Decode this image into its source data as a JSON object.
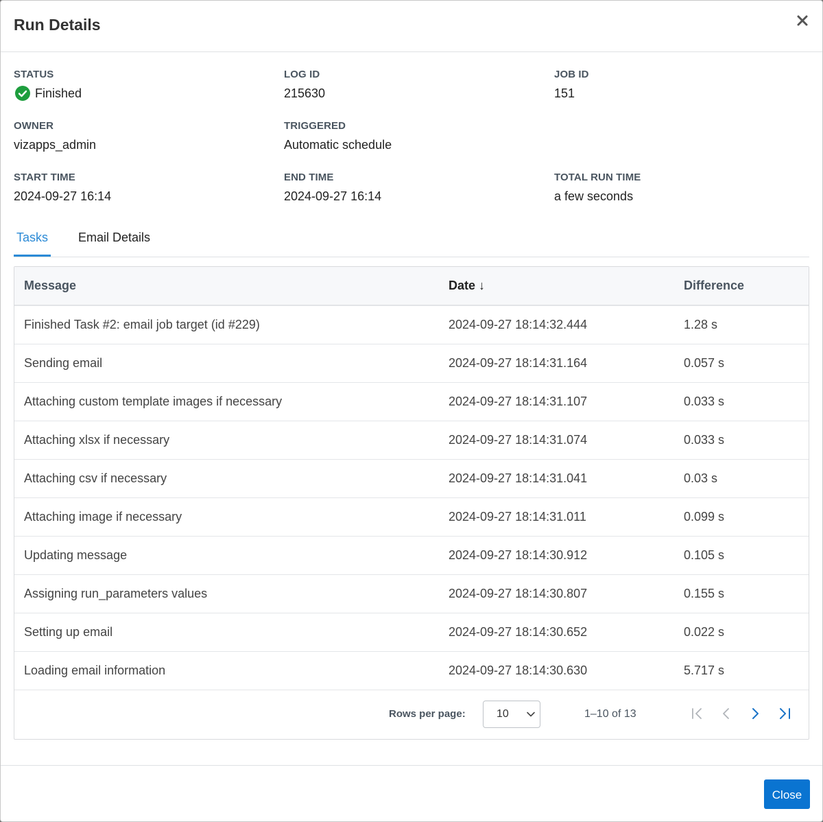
{
  "modal": {
    "title": "Run Details",
    "close_icon": "close-icon"
  },
  "details": {
    "status": {
      "label": "STATUS",
      "value": "Finished",
      "icon": "check-circle-icon",
      "color": "#1e9e3e"
    },
    "log_id": {
      "label": "LOG ID",
      "value": "215630"
    },
    "job_id": {
      "label": "JOB ID",
      "value": "151"
    },
    "owner": {
      "label": "OWNER",
      "value": "vizapps_admin"
    },
    "triggered": {
      "label": "TRIGGERED",
      "value": "Automatic schedule"
    },
    "start_time": {
      "label": "START TIME",
      "value": "2024-09-27 16:14"
    },
    "end_time": {
      "label": "END TIME",
      "value": "2024-09-27 16:14"
    },
    "total_run_time": {
      "label": "TOTAL RUN TIME",
      "value": "a few seconds"
    }
  },
  "tabs": [
    {
      "label": "Tasks",
      "active": true
    },
    {
      "label": "Email Details",
      "active": false
    }
  ],
  "table": {
    "columns": [
      "Message",
      "Date ↓",
      "Difference"
    ],
    "sort_icon": "arrow-down-icon",
    "rows": [
      {
        "message": "Finished Task #2: email job target (id #229)",
        "date": "2024-09-27 18:14:32.444",
        "difference": "1.28 s"
      },
      {
        "message": "Sending email",
        "date": "2024-09-27 18:14:31.164",
        "difference": "0.057 s"
      },
      {
        "message": "Attaching custom template images if necessary",
        "date": "2024-09-27 18:14:31.107",
        "difference": "0.033 s"
      },
      {
        "message": "Attaching xlsx if necessary",
        "date": "2024-09-27 18:14:31.074",
        "difference": "0.033 s"
      },
      {
        "message": "Attaching csv if necessary",
        "date": "2024-09-27 18:14:31.041",
        "difference": "0.03 s"
      },
      {
        "message": "Attaching image if necessary",
        "date": "2024-09-27 18:14:31.011",
        "difference": "0.099 s"
      },
      {
        "message": "Updating message",
        "date": "2024-09-27 18:14:30.912",
        "difference": "0.105 s"
      },
      {
        "message": "Assigning run_parameters values",
        "date": "2024-09-27 18:14:30.807",
        "difference": "0.155 s"
      },
      {
        "message": "Setting up email",
        "date": "2024-09-27 18:14:30.652",
        "difference": "0.022 s"
      },
      {
        "message": "Loading email information",
        "date": "2024-09-27 18:14:30.630",
        "difference": "5.717 s"
      }
    ]
  },
  "pagination": {
    "rows_per_page_label": "Rows per page:",
    "rows_per_page_value": "10",
    "range": "1–10 of 13",
    "icons": [
      "first-page-icon",
      "previous-page-icon",
      "next-page-icon",
      "last-page-icon"
    ]
  },
  "footer": {
    "close_label": "Close"
  },
  "colors": {
    "accent": "#2b8ad6",
    "primary_button": "#0a74d1",
    "success": "#1e9e3e",
    "disabled_icon": "#b0b4b9"
  }
}
